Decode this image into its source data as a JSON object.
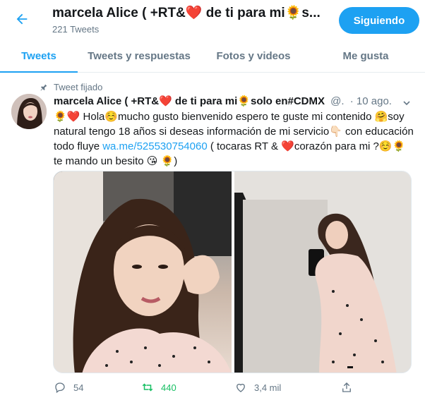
{
  "header": {
    "title": "marcela Alice ( +RT&❤️ de ti para mi🌻s...",
    "tweet_count": "221 Tweets",
    "follow_label": "Siguiendo"
  },
  "tabs": [
    {
      "label": "Tweets",
      "active": true
    },
    {
      "label": "Tweets y respuestas",
      "active": false
    },
    {
      "label": "Fotos y videos",
      "active": false
    },
    {
      "label": "Me gusta",
      "active": false
    }
  ],
  "tweet": {
    "pinned_label": "Tweet fijado",
    "name": "marcela Alice ( +RT&❤️ de ti para mi🌻solo en#CDMX",
    "handle": "@.",
    "date": "· 10 ago.",
    "text_part1": "🌻❤️ Hola☺️mucho gusto bienvenido espero te guste mi contenido 🤗soy natural tengo 18 años si deseas información de mi servicio👇🏻 con educación todo fluye ",
    "link": "wa.me/525530754060",
    "text_part2": "          ( tocaras RT & ❤️corazón para mi ?☺️🌻 te mando un besito 😘 🌻)",
    "replies": "54",
    "retweets": "440",
    "likes": "3,4 mil"
  },
  "colors": {
    "accent": "#1da1f2",
    "retweet": "#17bf63",
    "muted": "#657786"
  }
}
